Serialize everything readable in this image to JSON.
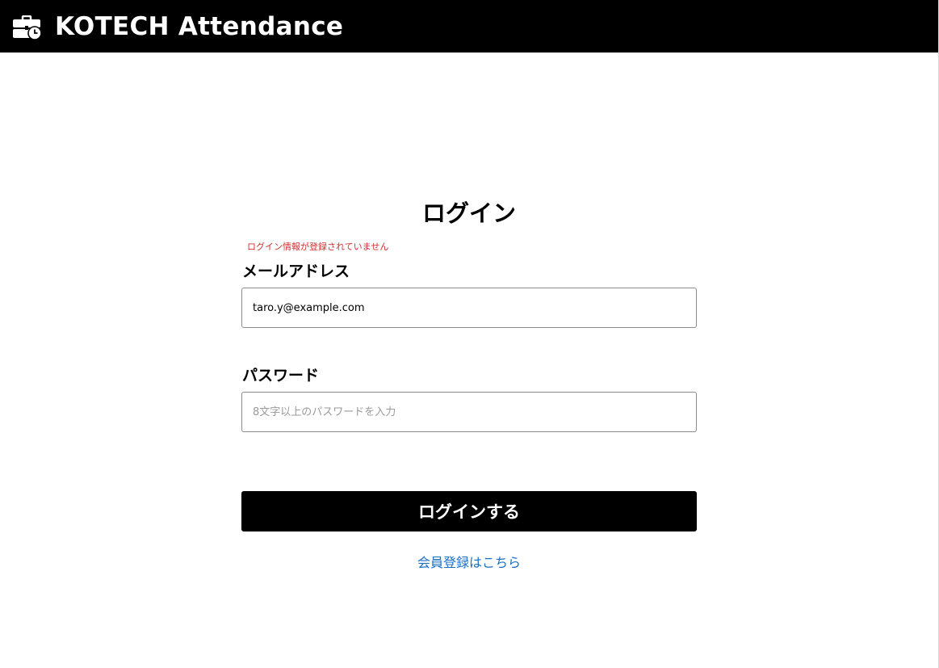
{
  "header": {
    "app_title": "KOTECH Attendance",
    "logo_icon": "briefcase-clock-icon",
    "background_color": "#000000"
  },
  "login": {
    "title": "ログイン",
    "error_message": "ログイン情報が登録されていません",
    "error_color": "#d32f2f",
    "email_label": "メールアドレス",
    "email_value": "taro.y@example.com",
    "password_label": "パスワード",
    "password_placeholder": "8文字以上のパスワードを入力",
    "submit_label": "ログインする",
    "register_link": "会員登録はこちら",
    "link_color": "#1a6fc4"
  }
}
